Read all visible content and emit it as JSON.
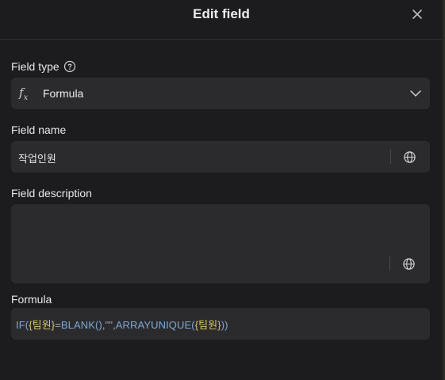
{
  "dialog": {
    "title": "Edit field"
  },
  "field_type": {
    "label": "Field type",
    "value": "Formula",
    "icon": "fx-icon"
  },
  "field_name": {
    "label": "Field name",
    "value": "작업인원"
  },
  "field_description": {
    "label": "Field description",
    "value": ""
  },
  "formula": {
    "label": "Formula",
    "tokens": [
      "IF(",
      "{팀원}",
      "=",
      "BLANK()",
      ",",
      "\"\"",
      ",",
      "ARRAYUNIQUE(",
      "{팀원}",
      "))"
    ]
  }
}
